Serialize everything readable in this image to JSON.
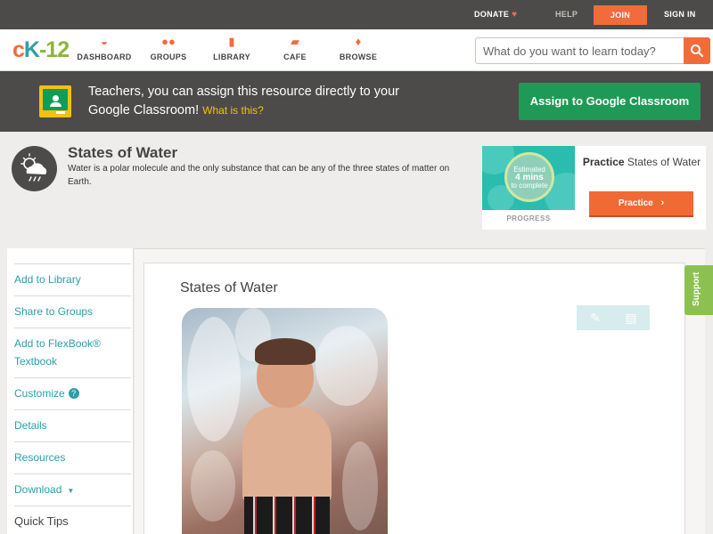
{
  "topbar": {
    "donate": "DONATE",
    "help": "HELP",
    "join": "JOIN",
    "sign_in": "SIGN IN"
  },
  "header": {
    "logo": {
      "c": "c",
      "k": "K",
      "dash": "-",
      "n": "12"
    },
    "nav": [
      {
        "label": "DASHBOARD",
        "icon": "dashboard-icon"
      },
      {
        "label": "GROUPS",
        "icon": "groups-icon"
      },
      {
        "label": "LIBRARY",
        "icon": "library-icon"
      },
      {
        "label": "CAFE",
        "icon": "cafe-icon"
      },
      {
        "label": "BROWSE",
        "icon": "browse-icon"
      }
    ],
    "search": {
      "placeholder": "What do you want to learn today?"
    }
  },
  "banner": {
    "text": "Teachers, you can assign this resource directly to your Google Classroom!",
    "what_link": "What is this?",
    "assign_button": "Assign to Google Classroom"
  },
  "concept": {
    "title": "States of Water",
    "description": "Water is a polar molecule and the only substance that can be any of the three states of matter on Earth."
  },
  "practice": {
    "estimated": "Estimated",
    "mins": "4 mins",
    "to_complete": "to complete",
    "progress_label": "PROGRESS",
    "heading_bold": "Practice",
    "heading_rest": "States of Water",
    "button": "Practice"
  },
  "sidebar": {
    "items": [
      "Add to Library",
      "Share to Groups",
      "Add to FlexBook® Textbook",
      "Customize",
      "Details",
      "Resources",
      "Download",
      "Quick Tips"
    ]
  },
  "main": {
    "title": "States of Water"
  },
  "support": "Support",
  "colors": {
    "accent_orange": "#f26b3a",
    "teal": "#2aa0a5",
    "classroom_green": "#1e9a56",
    "support_green": "#8cc152",
    "dark_bar": "#4c4b49"
  }
}
